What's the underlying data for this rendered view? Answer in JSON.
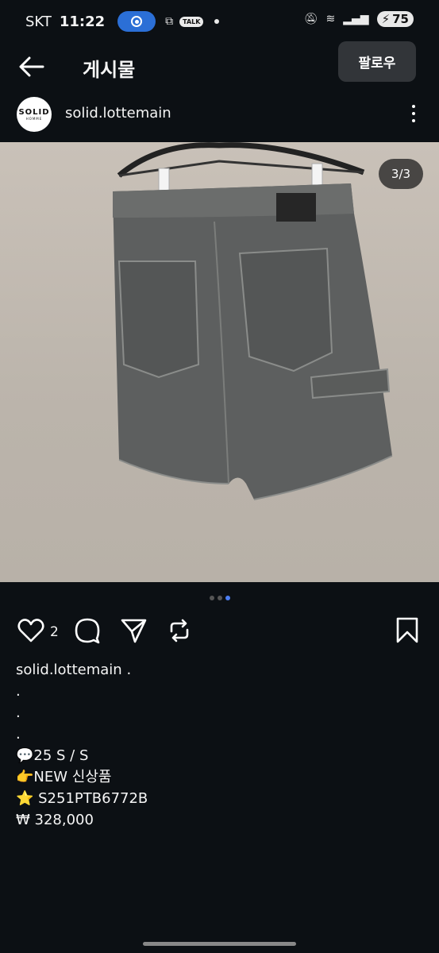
{
  "status_bar": {
    "carrier": "SKT",
    "time": "11:22",
    "battery": "75"
  },
  "header": {
    "title": "게시물",
    "follow_label": "팔로우"
  },
  "post": {
    "username": "solid.lottemain",
    "avatar_logo": "SOLID",
    "avatar_sub": "HOMME",
    "image_counter": "3/3",
    "like_count": "2"
  },
  "caption": {
    "lines": [
      "solid.lottemain .",
      ".",
      ".",
      ".",
      "",
      "💬25 S / S",
      "",
      "👉NEW 신상품",
      "",
      "⭐ S251PTB6772B",
      "",
      "₩ 328,000"
    ]
  },
  "colors": {
    "background": "#0c1014",
    "accent_dot": "#4c7ef3",
    "follow_button": "#323539"
  }
}
